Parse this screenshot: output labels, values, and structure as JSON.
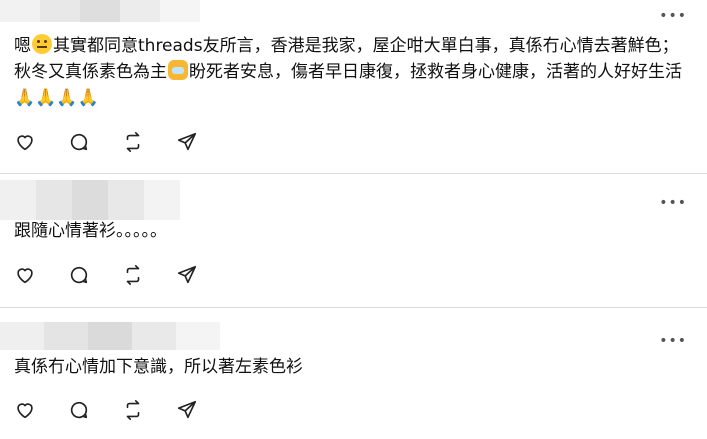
{
  "more_label": "•••",
  "posts": [
    {
      "text": "嗯😐其實都同意threads友所言，香港是我家，屋企咁大單白事，真係冇心情去著鮮色；秋冬又真係素色為主😿盼死者安息，傷者早日康復，拯救者身心健康，活著的人好好生活🙏🙏🙏🙏",
      "text_a": "嗯",
      "text_b": "其實都同意threads友所言，香港是我家，屋企咁大單白事，真係冇心情去著鮮色；秋冬又真係素色為主",
      "text_c": "盼死者安息，傷者早日康復，拯救者身心健康，活著的人好好生活🙏🙏🙏🙏"
    },
    {
      "text": "跟隨心情著衫。。。。。"
    },
    {
      "text": "真係冇心情加下意識，所以著左素色衫"
    }
  ],
  "icons": [
    "heart-icon",
    "comment-icon",
    "repost-icon",
    "share-icon"
  ]
}
